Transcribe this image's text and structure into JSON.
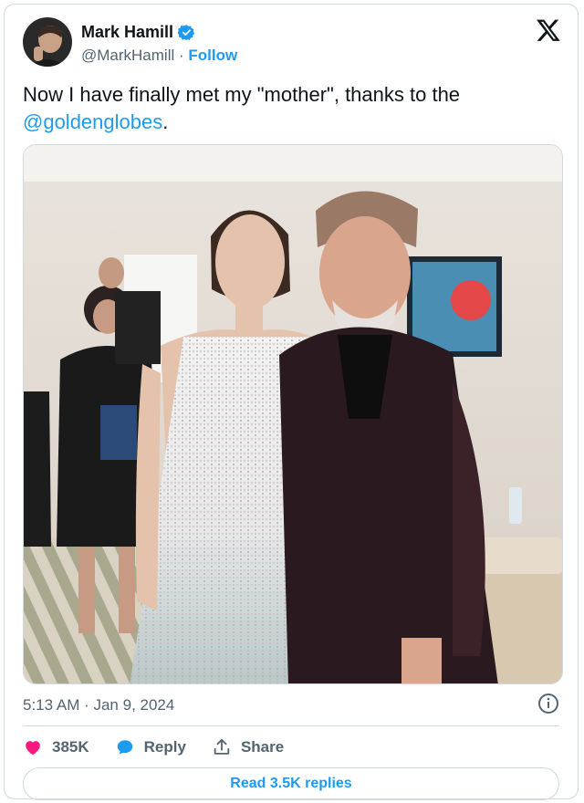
{
  "author": {
    "name": "Mark Hamill",
    "handle": "@MarkHamill",
    "separator": "·",
    "follow_label": "Follow"
  },
  "tweet": {
    "text_before": "Now I have finally met my \"mother\", thanks to the",
    "mention": "@goldenglobes",
    "text_after": "."
  },
  "meta": {
    "timestamp": "5:13 AM · Jan 9, 2024"
  },
  "actions": {
    "likes_count": "385K",
    "reply_label": "Reply",
    "share_label": "Share"
  },
  "footer": {
    "read_replies_label": "Read 3.5K replies"
  },
  "colors": {
    "accent": "#1d9bf0",
    "like": "#f91880",
    "text": "#0f1419",
    "muted": "#536471",
    "border": "#cfd9de"
  }
}
